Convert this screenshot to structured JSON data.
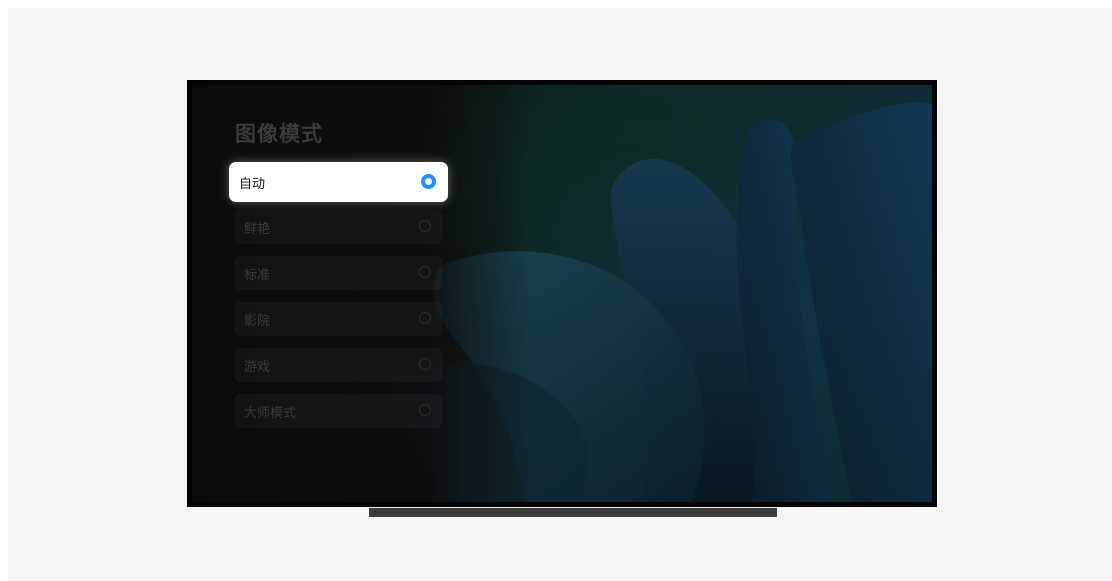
{
  "panel": {
    "title": "图像模式",
    "options": [
      {
        "label": "自动",
        "selected": true
      },
      {
        "label": "鲜艳",
        "selected": false
      },
      {
        "label": "标准",
        "selected": false
      },
      {
        "label": "影院",
        "selected": false
      },
      {
        "label": "游戏",
        "selected": false
      },
      {
        "label": "大师模式",
        "selected": false
      }
    ]
  },
  "colors": {
    "accent": "#1e90ff",
    "background": "#f5f5f5",
    "tv_frame": "#050505"
  }
}
